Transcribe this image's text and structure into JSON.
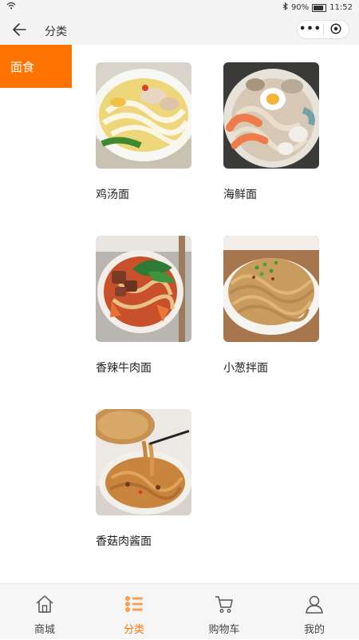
{
  "status_bar": {
    "battery": "90%",
    "time": "11:52"
  },
  "nav": {
    "title": "分类",
    "more_label": "•••"
  },
  "sidebar": {
    "items": [
      {
        "label": "面食",
        "active": true
      }
    ]
  },
  "products": [
    {
      "name": "鸡汤面"
    },
    {
      "name": "海鲜面"
    },
    {
      "name": "香辣牛肉面"
    },
    {
      "name": "小葱拌面"
    },
    {
      "name": "香菇肉酱面"
    }
  ],
  "tabbar": {
    "items": [
      {
        "label": "商城",
        "icon": "home-icon"
      },
      {
        "label": "分类",
        "icon": "category-icon",
        "active": true
      },
      {
        "label": "购物车",
        "icon": "cart-icon"
      },
      {
        "label": "我的",
        "icon": "user-icon"
      }
    ]
  },
  "colors": {
    "accent": "#ff7300",
    "bar_bg": "#f4f4f4"
  }
}
